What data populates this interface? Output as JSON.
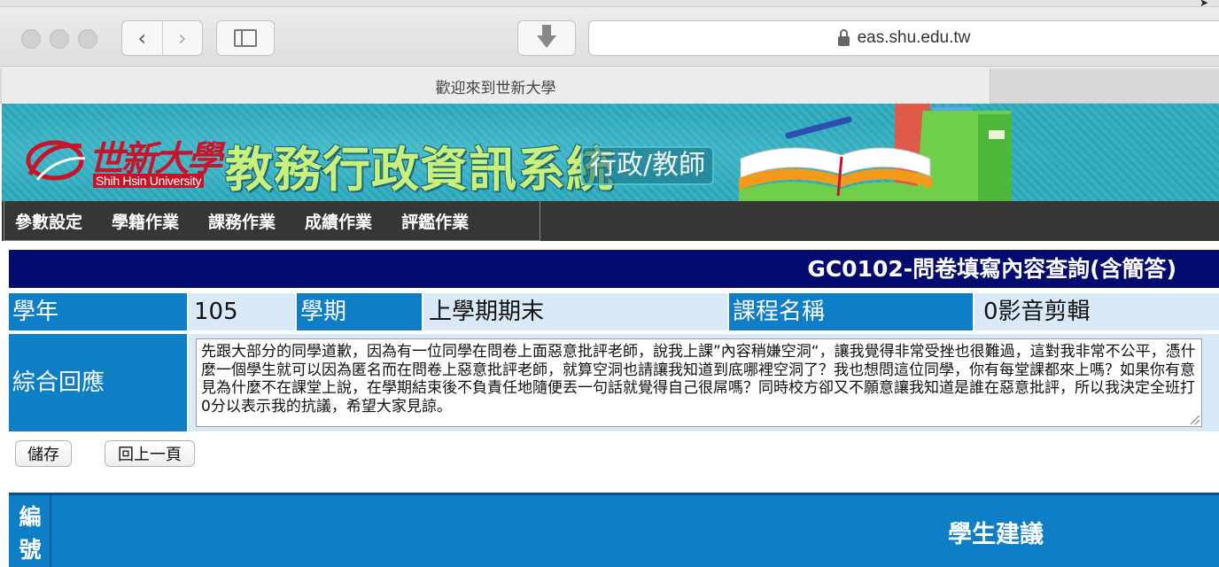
{
  "browser": {
    "url": "eas.shu.edu.tw",
    "tab_title": "歡迎來到世新大學"
  },
  "banner": {
    "logo_cn": "世新大學",
    "logo_en": "Shih Hsin University",
    "system_title": "教務行政資訊系統",
    "role": "行政/教師"
  },
  "menu": {
    "items": [
      {
        "label": "參數設定"
      },
      {
        "label": "學籍作業"
      },
      {
        "label": "課務作業"
      },
      {
        "label": "成績作業"
      },
      {
        "label": "評鑑作業"
      }
    ]
  },
  "page": {
    "title": "GC0102-問卷填寫內容查詢(含簡答)"
  },
  "info": {
    "year_label": "學年",
    "year_value": "105",
    "semester_label": "學期",
    "semester_value": "上學期期末",
    "course_label": "課程名稱",
    "course_value": "0影音剪輯"
  },
  "response": {
    "label": "綜合回應",
    "text": "先跟大部分的同學道歉，因為有一位同學在問卷上面惡意批評老師，說我上課”內容稍嫌空洞“，讓我覺得非常受挫也很難過，這對我非常不公平，憑什麼一個學生就可以因為匿名而在問卷上惡意批評老師，就算空洞也請讓我知道到底哪裡空洞了？我也想問這位同學，你有每堂課都來上嗎？如果你有意見為什麼不在課堂上說，在學期結束後不負責任地隨便丟一句話就覺得自己很屌嗎？同時校方卻又不願意讓我知道是誰在惡意批評，所以我決定全班打0分以表示我的抗議，希望大家見諒。"
  },
  "buttons": {
    "save": "儲存",
    "back": "回上一頁"
  },
  "table": {
    "col_id_char1": "編",
    "col_id_char2": "號",
    "col_suggestion": "學生建議"
  },
  "colors": {
    "title_bar": "#050a6e",
    "label_bg": "#0e7fc6",
    "value_bg": "#d9e9f7",
    "menu_bg": "#363636",
    "system_title": "#c9f07a",
    "logo_red": "#c8142b"
  }
}
